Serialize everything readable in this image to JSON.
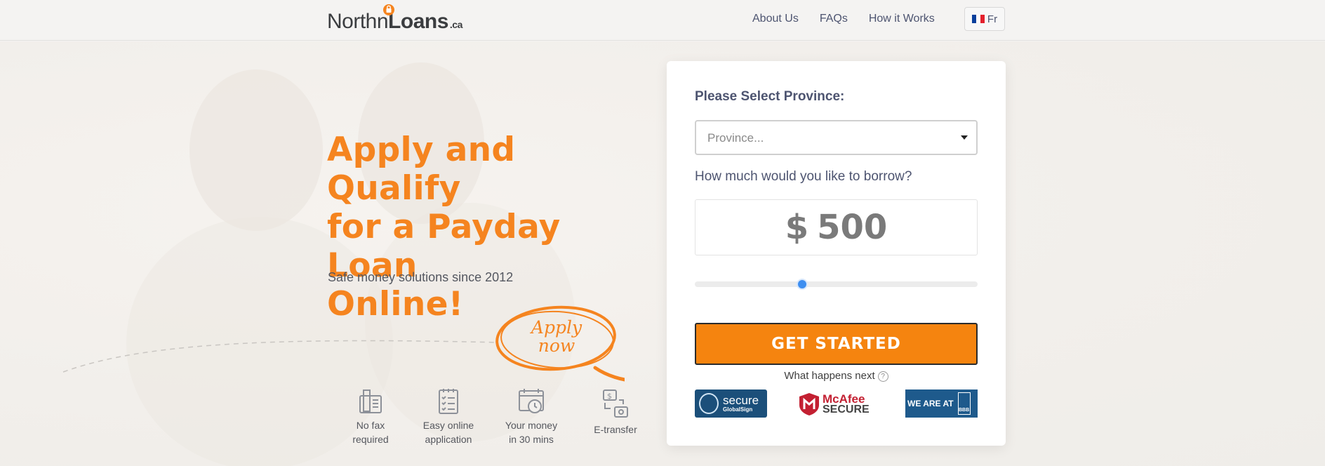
{
  "header": {
    "logo": {
      "part1": "North",
      "part2": "n",
      "part3": "Loans",
      "suffix": ".ca"
    },
    "nav": [
      {
        "label": "About Us"
      },
      {
        "label": "FAQs"
      },
      {
        "label": "How it Works"
      }
    ],
    "language": {
      "label": "Fr",
      "flag_icon": "france-flag-icon"
    }
  },
  "hero": {
    "headline_lines": [
      "Apply and Qualify",
      "for a Payday Loan",
      "Online!"
    ],
    "tagline": "Safe money solutions since 2012",
    "apply_now": {
      "line1": "Apply",
      "line2": "now"
    },
    "features": [
      {
        "icon": "fax-machine-icon",
        "line1": "No fax",
        "line2": "required"
      },
      {
        "icon": "clipboard-checklist-icon",
        "line1": "Easy online",
        "line2": "application"
      },
      {
        "icon": "calendar-clock-icon",
        "line1": "Your money",
        "line2": "in 30 mins"
      },
      {
        "icon": "e-transfer-icon",
        "line1": "E-transfer",
        "line2": ""
      }
    ]
  },
  "form": {
    "province_label": "Please Select Province:",
    "province_placeholder": "Province...",
    "borrow_label": "How much would you like to borrow?",
    "amount": {
      "currency": "$",
      "value": "500"
    },
    "slider_position": 0.38,
    "cta_label": "GET STARTED",
    "next_label": "What happens next",
    "badges": {
      "secure": {
        "line1": "secure",
        "line2": "GlobalSign"
      },
      "mcafee": {
        "line1": "McAfee",
        "line2": "SECURE"
      },
      "bbb": {
        "line1": "WE ARE AT",
        "line2": "BBB"
      }
    }
  },
  "colors": {
    "accent": "#f5841f",
    "button": "#f5840f",
    "slider": "#3d8ef0",
    "nav_text": "#4d5470"
  }
}
